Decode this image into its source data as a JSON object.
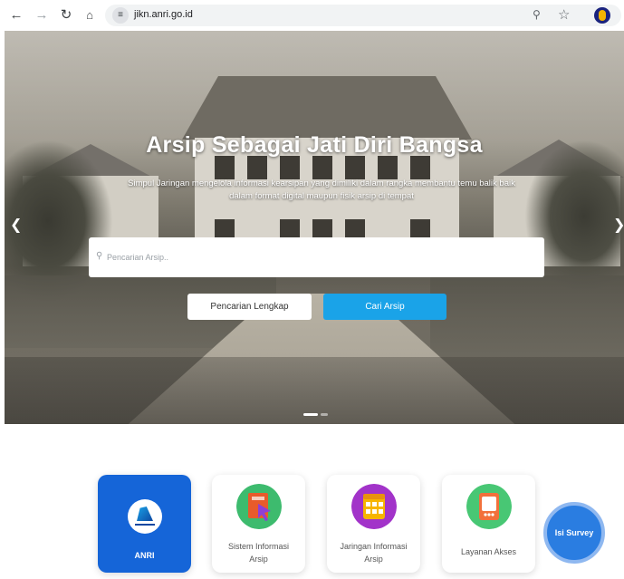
{
  "browser": {
    "url": "jikn.anri.go.id",
    "icons": [
      "back-icon",
      "forward-icon",
      "reload-icon",
      "home-icon",
      "site-info-icon",
      "zoom-icon",
      "star-icon",
      "profile-icon"
    ]
  },
  "hero": {
    "title": "Arsip Sebagai Jati Diri Bangsa",
    "subtitle": "Simpul Jaringan mengelola informasi kearsipan yang dimiliki dalam rangka membantu temu balik baik dalam format digital maupun fisik arsip di tempat",
    "search_placeholder": "Pencarian Arsip..",
    "btn_full_search": "Pencarian Lengkap",
    "btn_search": "Cari Arsip",
    "accent_color": "#1aa3e8"
  },
  "services": [
    {
      "label": "ANRI",
      "active": true
    },
    {
      "label": "Sistem Informasi Arsip",
      "active": false
    },
    {
      "label": "Jaringan Informasi Arsip",
      "active": false
    },
    {
      "label": "Layanan Akses",
      "active": false
    }
  ],
  "survey": {
    "label": "Isi Survey"
  }
}
